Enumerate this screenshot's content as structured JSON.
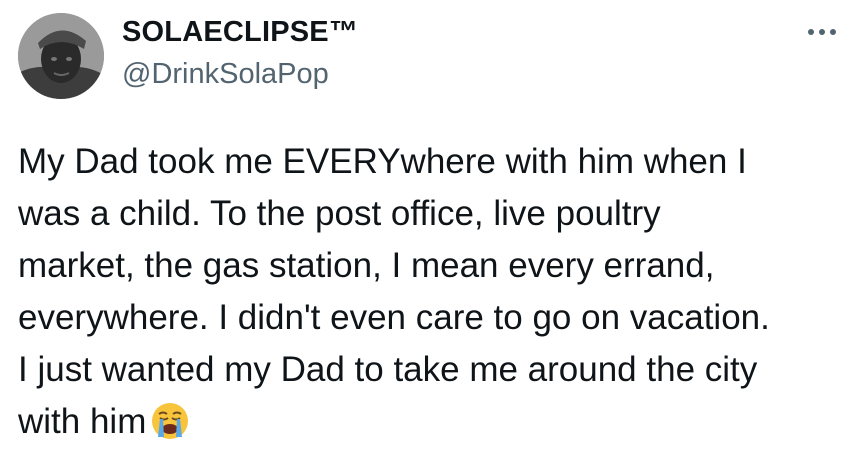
{
  "author": {
    "display_name": "SOLAECLIPSE™",
    "handle": "@DrinkSolaPop",
    "avatar_icon": "profile-photo"
  },
  "more_icon": "more-horizontal-icon",
  "tweet": {
    "lines": [
      "My Dad took me EVERYwhere with him when I",
      "was a child. To the post office, live poultry",
      "market, the gas station, I mean every errand,",
      "everywhere. I didn't even care to go on vacation.",
      "I just wanted my Dad to take me around the city",
      "with him"
    ],
    "emoji": "loudly-crying-face-emoji"
  },
  "colors": {
    "text": "#0f1419",
    "secondary": "#536471",
    "background": "#ffffff"
  }
}
